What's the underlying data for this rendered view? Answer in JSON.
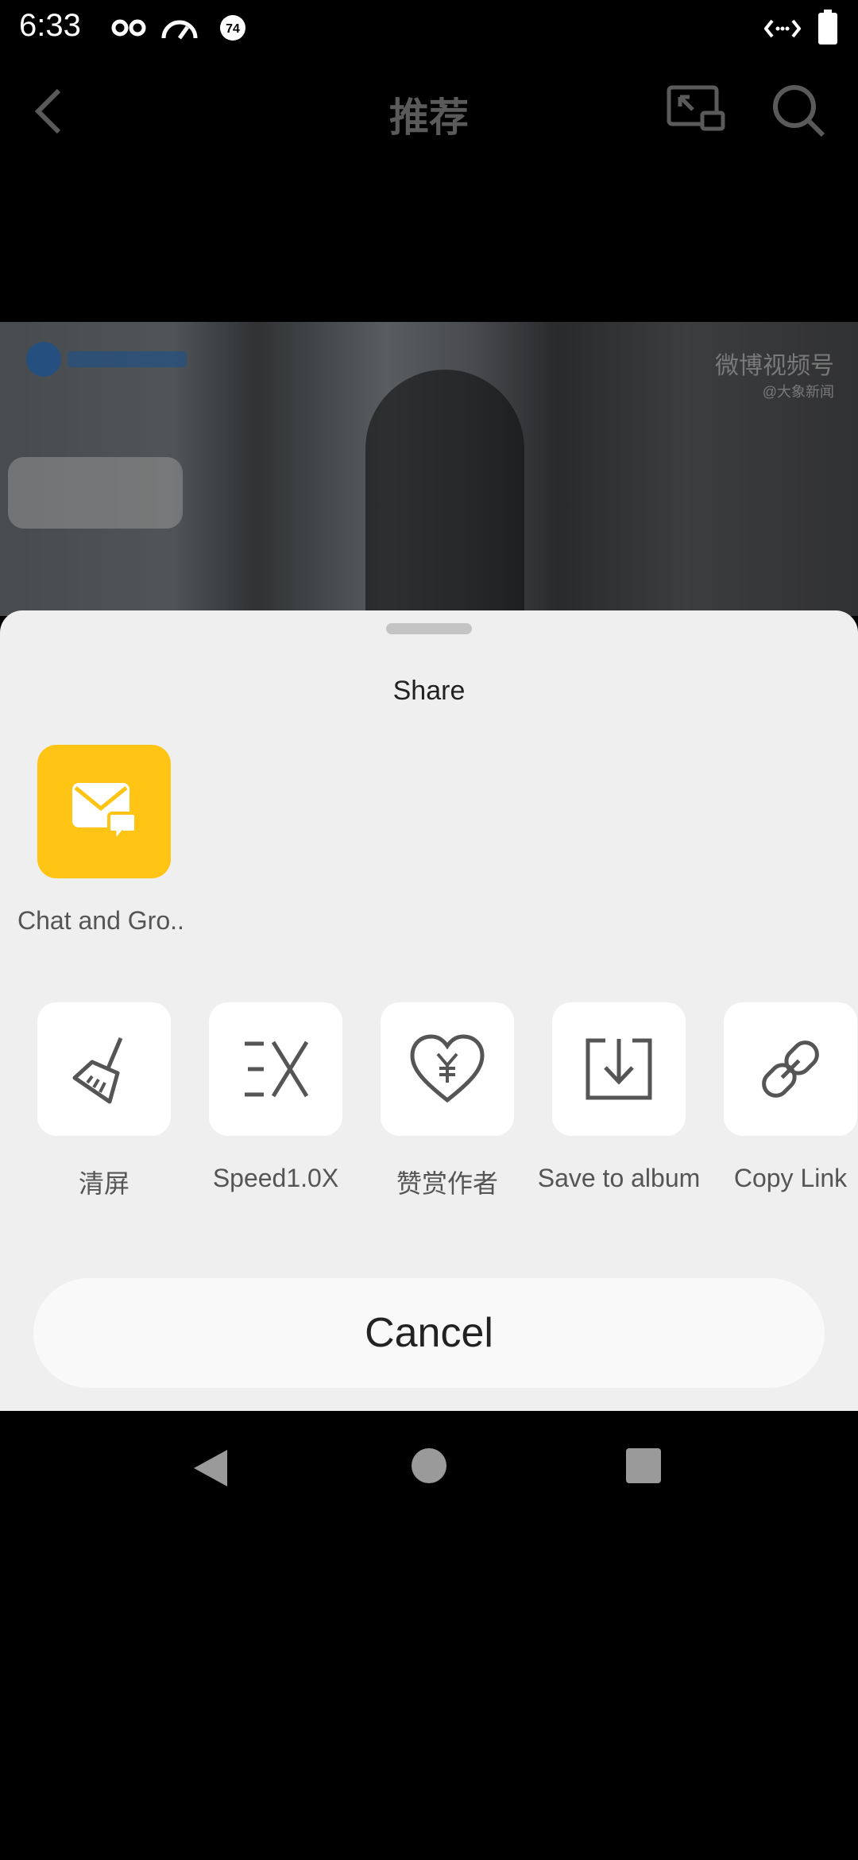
{
  "status_bar": {
    "time": "6:33",
    "icons": [
      "incognito-icon",
      "speedometer-icon",
      "notification-74-icon",
      "data-transfer-icon",
      "battery-icon"
    ],
    "badge": "74"
  },
  "app_bar": {
    "title": "推荐",
    "icons": [
      "back-icon",
      "picture-in-picture-icon",
      "search-icon"
    ]
  },
  "video": {
    "watermark_title": "微博视频号",
    "watermark_sub": "@大象新闻"
  },
  "share_sheet": {
    "title": "Share",
    "apps": [
      {
        "label": "Chat and Gro..",
        "icon": "mail-chat-icon",
        "color": "#ffc414"
      }
    ],
    "actions": [
      {
        "label": "清屏",
        "icon": "broom-icon"
      },
      {
        "label": "Speed1.0X",
        "icon": "speed-icon"
      },
      {
        "label": "赞赏作者",
        "icon": "heart-yen-icon"
      },
      {
        "label": "Save to album",
        "icon": "download-icon"
      },
      {
        "label": "Copy Link",
        "icon": "link-icon"
      }
    ],
    "cancel_label": "Cancel"
  },
  "nav_bar": {
    "icons": [
      "nav-back-icon",
      "nav-home-icon",
      "nav-recents-icon"
    ]
  }
}
